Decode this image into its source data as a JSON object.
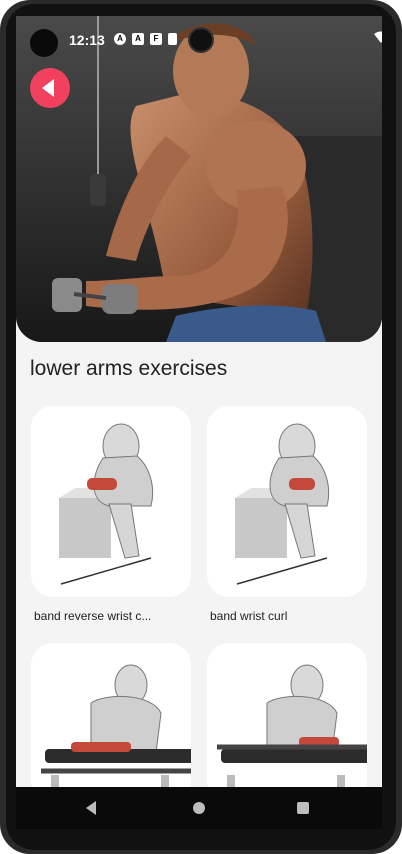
{
  "status_bar": {
    "time": "12:13",
    "icons": [
      "app-a-icon",
      "app-a-square-icon",
      "app-f-icon",
      "sim-card-icon",
      "wifi-icon",
      "cell-signal-icon",
      "battery-icon"
    ]
  },
  "hero": {
    "image": "bodybuilder-cable-curl-photo",
    "back_icon": "back-arrow-icon",
    "accent_color": "#f2405f"
  },
  "section": {
    "title": "lower arms exercises"
  },
  "exercises": [
    {
      "name": "band reverse wrist c...",
      "image": "band-reverse-wrist-curl-illustration"
    },
    {
      "name": "band wrist curl",
      "image": "band-wrist-curl-illustration"
    },
    {
      "name": "",
      "image": "barbell-reverse-wrist-curl-illustration"
    },
    {
      "name": "",
      "image": "barbell-wrist-curl-illustration"
    }
  ],
  "nav": {
    "back_icon": "nav-back-icon",
    "home_icon": "nav-home-icon",
    "recents_icon": "nav-recents-icon"
  }
}
